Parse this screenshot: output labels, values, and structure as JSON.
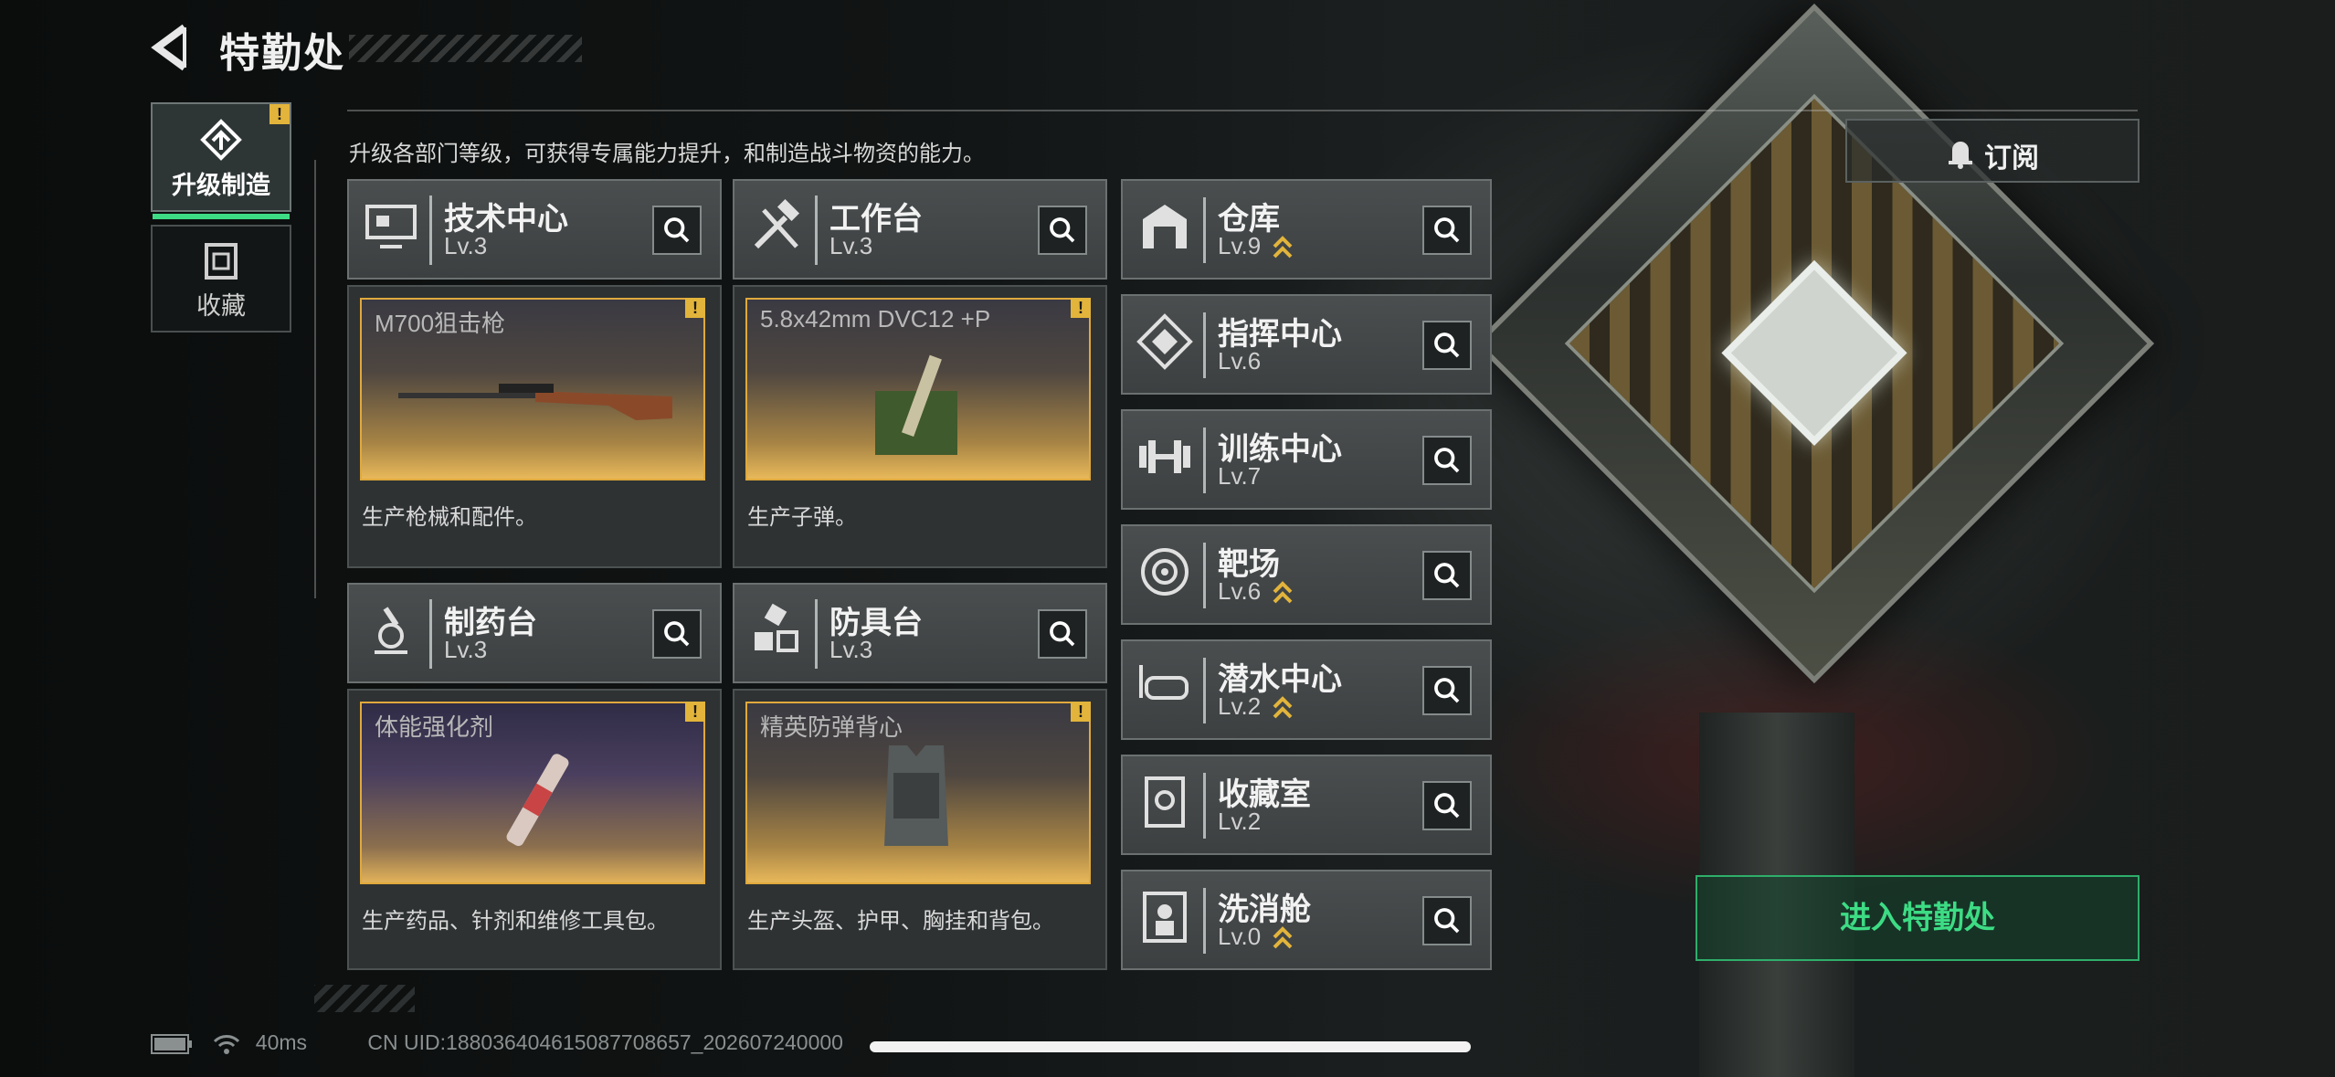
{
  "header": {
    "title": "特勤处"
  },
  "nav": [
    {
      "label": "升级制造",
      "active": true,
      "warn": "!"
    },
    {
      "label": "收藏",
      "active": false
    }
  ],
  "subtitle": "升级各部门等级，可获得专属能力提升，和制造战斗物资的能力。",
  "production": [
    {
      "name": "技术中心",
      "level": "Lv.3",
      "item": "M700狙击枪",
      "desc": "生产枪械和配件。",
      "warn": "!"
    },
    {
      "name": "工作台",
      "level": "Lv.3",
      "item": "5.8x42mm DVC12 +P",
      "desc": "生产子弹。",
      "warn": "!"
    },
    {
      "name": "制药台",
      "level": "Lv.3",
      "item": "体能强化剂",
      "desc": "生产药品、针剂和维修工具包。",
      "warn": "!"
    },
    {
      "name": "防具台",
      "level": "Lv.3",
      "item": "精英防弹背心",
      "desc": "生产头盔、护甲、胸挂和背包。",
      "warn": "!"
    }
  ],
  "departments": [
    {
      "name": "仓库",
      "level": "Lv.9",
      "upgradable": true,
      "icon": "warehouse-icon"
    },
    {
      "name": "指挥中心",
      "level": "Lv.6",
      "upgradable": false,
      "icon": "command-center-icon"
    },
    {
      "name": "训练中心",
      "level": "Lv.7",
      "upgradable": false,
      "icon": "dumbbell-icon"
    },
    {
      "name": "靶场",
      "level": "Lv.6",
      "upgradable": true,
      "icon": "target-icon"
    },
    {
      "name": "潜水中心",
      "level": "Lv.2",
      "upgradable": true,
      "icon": "diving-mask-icon"
    },
    {
      "name": "收藏室",
      "level": "Lv.2",
      "upgradable": false,
      "icon": "collection-icon"
    },
    {
      "name": "洗消舱",
      "level": "Lv.0",
      "upgradable": true,
      "icon": "decon-icon"
    }
  ],
  "subscribe": {
    "label": "订阅"
  },
  "enter": {
    "label": "进入特勤处"
  },
  "status": {
    "ping": "40ms",
    "uid": "CN UID:18803640461508770865​7_202607240000"
  },
  "colors": {
    "accent": "#3ddc84",
    "warn": "#e2b43b",
    "frame": "#e0a93c"
  }
}
